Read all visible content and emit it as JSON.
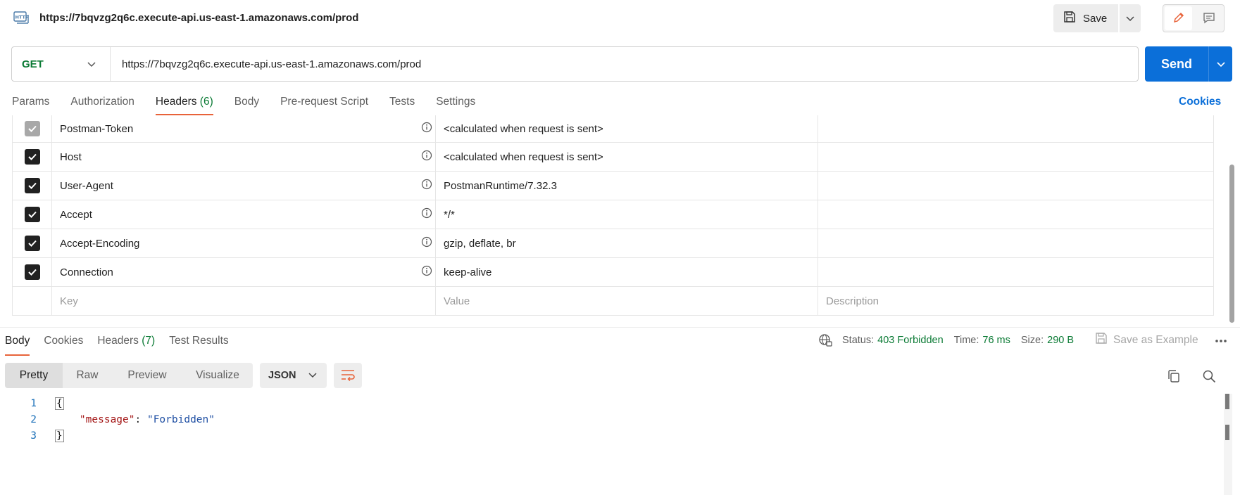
{
  "titlebar": {
    "icon": "http-icon",
    "title": "https://7bqvzg2q6c.execute-api.us-east-1.amazonaws.com/prod",
    "save_label": "Save"
  },
  "request": {
    "method": "GET",
    "url": "https://7bqvzg2q6c.execute-api.us-east-1.amazonaws.com/prod",
    "send_label": "Send"
  },
  "request_tabs": [
    {
      "label": "Params",
      "count": ""
    },
    {
      "label": "Authorization",
      "count": ""
    },
    {
      "label": "Headers",
      "count": "(6)"
    },
    {
      "label": "Body",
      "count": ""
    },
    {
      "label": "Pre-request Script",
      "count": ""
    },
    {
      "label": "Tests",
      "count": ""
    },
    {
      "label": "Settings",
      "count": ""
    }
  ],
  "active_request_tab": "Headers",
  "cookies_link": "Cookies",
  "headers": [
    {
      "key": "Postman-Token",
      "value": "<calculated when request is sent>",
      "checked": true,
      "disabled": true
    },
    {
      "key": "Host",
      "value": "<calculated when request is sent>",
      "checked": true,
      "disabled": false
    },
    {
      "key": "User-Agent",
      "value": "PostmanRuntime/7.32.3",
      "checked": true,
      "disabled": false
    },
    {
      "key": "Accept",
      "value": "*/*",
      "checked": true,
      "disabled": false
    },
    {
      "key": "Accept-Encoding",
      "value": "gzip, deflate, br",
      "checked": true,
      "disabled": false
    },
    {
      "key": "Connection",
      "value": "keep-alive",
      "checked": true,
      "disabled": false
    }
  ],
  "headers_placeholder": {
    "key": "Key",
    "value": "Value",
    "description": "Description"
  },
  "response_tabs": [
    {
      "label": "Body",
      "count": ""
    },
    {
      "label": "Cookies",
      "count": ""
    },
    {
      "label": "Headers",
      "count": "(7)"
    },
    {
      "label": "Test Results",
      "count": ""
    }
  ],
  "response_status": {
    "status_label": "Status:",
    "status_value": "403 Forbidden",
    "time_label": "Time:",
    "time_value": "76 ms",
    "size_label": "Size:",
    "size_value": "290 B",
    "save_example": "Save as Example"
  },
  "format_options": [
    "Pretty",
    "Raw",
    "Preview",
    "Visualize"
  ],
  "active_format": "Pretty",
  "language": "JSON",
  "code_lines": [
    {
      "n": "1",
      "open": "{"
    },
    {
      "n": "2",
      "key": "\"message\"",
      "sep": ": ",
      "value": "\"Forbidden\""
    },
    {
      "n": "3",
      "close": "}"
    }
  ],
  "colors": {
    "accent_orange": "#e8633a",
    "send_blue": "#0b6fd9",
    "method_green": "#0a7a34",
    "status_green": "#0a7a34"
  }
}
